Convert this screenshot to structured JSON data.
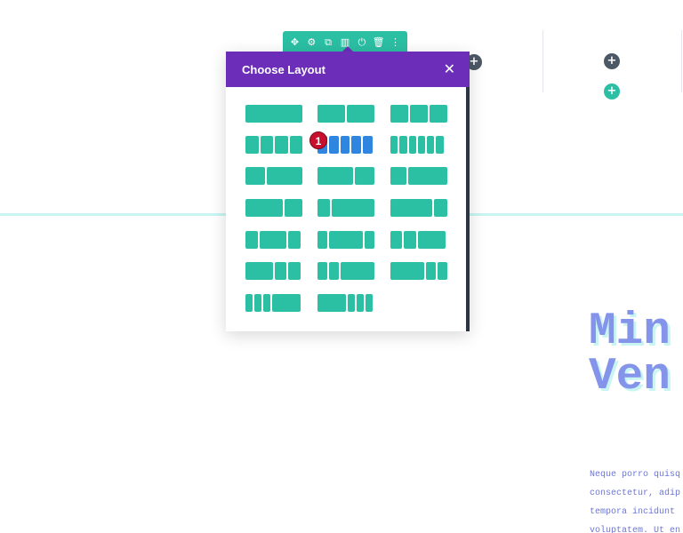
{
  "toolbar": {
    "icons": [
      "move-icon",
      "gear-icon",
      "duplicate-icon",
      "columns-icon",
      "power-icon",
      "trash-icon",
      "more-icon"
    ]
  },
  "modal": {
    "title": "Choose Layout",
    "close_glyph": "✕",
    "selected_layout": "five-columns"
  },
  "round_buttons": {
    "plus_glyph": "+"
  },
  "badge": {
    "label": "1"
  },
  "hero": {
    "title_line1": "Min",
    "title_line2": "Ven",
    "body_lines": [
      "Neque porro quisq",
      "consectetur, adip",
      "tempora incidunt",
      "voluptatem. Ut en"
    ]
  },
  "colors": {
    "accent_teal": "#2bbfa4",
    "header_purple": "#6c2eb9",
    "selected_blue": "#2e86e0",
    "badge_red": "#c8102e",
    "heading_blue": "#8494ea"
  }
}
